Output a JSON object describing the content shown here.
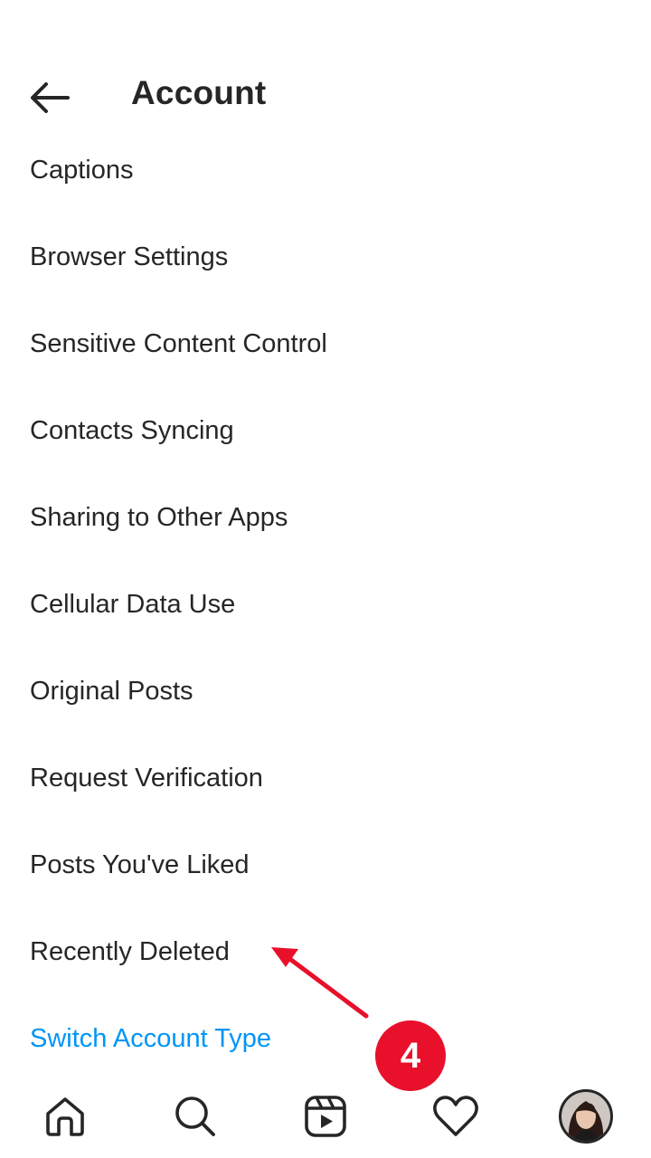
{
  "header": {
    "title": "Account",
    "back_icon": "arrow-left-icon"
  },
  "menu": {
    "items": [
      {
        "label": "Captions"
      },
      {
        "label": "Browser Settings"
      },
      {
        "label": "Sensitive Content Control"
      },
      {
        "label": "Contacts Syncing"
      },
      {
        "label": "Sharing to Other Apps"
      },
      {
        "label": "Cellular Data Use"
      },
      {
        "label": "Original Posts"
      },
      {
        "label": "Request Verification"
      },
      {
        "label": "Posts You've Liked"
      },
      {
        "label": "Recently Deleted"
      },
      {
        "label": "Switch Account Type",
        "color": "#0095f6"
      }
    ]
  },
  "bottom_nav": {
    "items": [
      "home-icon",
      "search-icon",
      "reels-icon",
      "heart-icon",
      "profile-avatar"
    ]
  },
  "annotation": {
    "step_number": "4",
    "color": "#e8102a"
  },
  "colors": {
    "text": "#262626",
    "link": "#0095f6",
    "background": "#ffffff"
  }
}
